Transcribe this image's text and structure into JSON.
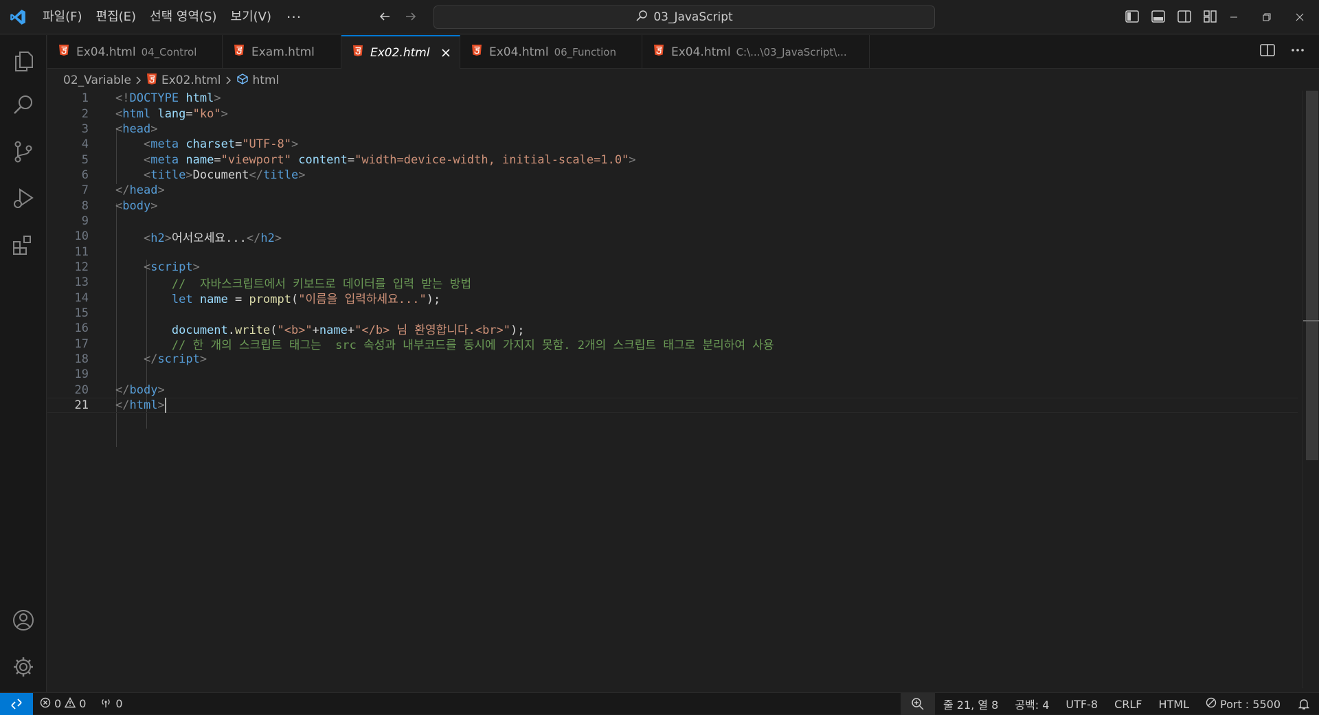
{
  "menu": {
    "items": [
      "파일(F)",
      "편집(E)",
      "선택 영역(S)",
      "보기(V)"
    ],
    "more": "···"
  },
  "search": {
    "text": "03_JavaScript"
  },
  "tabs": [
    {
      "name": "Ex04.html",
      "desc": "04_Control"
    },
    {
      "name": "Exam.html",
      "desc": ""
    },
    {
      "name": "Ex02.html",
      "desc": "",
      "active": true
    },
    {
      "name": "Ex04.html",
      "desc": "06_Function"
    },
    {
      "name": "Ex04.html",
      "desc": "C:\\...\\03_JavaScript\\..."
    }
  ],
  "breadcrumb": {
    "folder": "02_Variable",
    "file": "Ex02.html",
    "symbol": "html"
  },
  "editor": {
    "current_line": 21,
    "lines": [
      [
        [
          "c-punc",
          "<!"
        ],
        [
          "c-tag",
          "DOCTYPE"
        ],
        [
          "c-text",
          " "
        ],
        [
          "c-attr",
          "html"
        ],
        [
          "c-punc",
          ">"
        ]
      ],
      [
        [
          "c-punc",
          "<"
        ],
        [
          "c-tag",
          "html"
        ],
        [
          "c-text",
          " "
        ],
        [
          "c-attr",
          "lang"
        ],
        [
          "c-text",
          "="
        ],
        [
          "c-str",
          "\"ko\""
        ],
        [
          "c-punc",
          ">"
        ]
      ],
      [
        [
          "c-punc",
          "<"
        ],
        [
          "c-tag",
          "head"
        ],
        [
          "c-punc",
          ">"
        ]
      ],
      [
        [
          "c-text",
          "    "
        ],
        [
          "c-punc",
          "<"
        ],
        [
          "c-tag",
          "meta"
        ],
        [
          "c-text",
          " "
        ],
        [
          "c-attr",
          "charset"
        ],
        [
          "c-text",
          "="
        ],
        [
          "c-str",
          "\"UTF-8\""
        ],
        [
          "c-punc",
          ">"
        ]
      ],
      [
        [
          "c-text",
          "    "
        ],
        [
          "c-punc",
          "<"
        ],
        [
          "c-tag",
          "meta"
        ],
        [
          "c-text",
          " "
        ],
        [
          "c-attr",
          "name"
        ],
        [
          "c-text",
          "="
        ],
        [
          "c-str",
          "\"viewport\""
        ],
        [
          "c-text",
          " "
        ],
        [
          "c-attr",
          "content"
        ],
        [
          "c-text",
          "="
        ],
        [
          "c-str",
          "\"width=device-width, initial-scale=1.0\""
        ],
        [
          "c-punc",
          ">"
        ]
      ],
      [
        [
          "c-text",
          "    "
        ],
        [
          "c-punc",
          "<"
        ],
        [
          "c-tag",
          "title"
        ],
        [
          "c-punc",
          ">"
        ],
        [
          "c-text",
          "Document"
        ],
        [
          "c-punc",
          "</"
        ],
        [
          "c-tag",
          "title"
        ],
        [
          "c-punc",
          ">"
        ]
      ],
      [
        [
          "c-punc",
          "</"
        ],
        [
          "c-tag",
          "head"
        ],
        [
          "c-punc",
          ">"
        ]
      ],
      [
        [
          "c-punc",
          "<"
        ],
        [
          "c-tag",
          "body"
        ],
        [
          "c-punc",
          ">"
        ]
      ],
      [],
      [
        [
          "c-text",
          "    "
        ],
        [
          "c-punc",
          "<"
        ],
        [
          "c-tag",
          "h2"
        ],
        [
          "c-punc",
          ">"
        ],
        [
          "c-text",
          "어서오세요..."
        ],
        [
          "c-punc",
          "</"
        ],
        [
          "c-tag",
          "h2"
        ],
        [
          "c-punc",
          ">"
        ]
      ],
      [],
      [
        [
          "c-text",
          "    "
        ],
        [
          "c-punc",
          "<"
        ],
        [
          "c-tag",
          "script"
        ],
        [
          "c-punc",
          ">"
        ]
      ],
      [
        [
          "c-text",
          "        "
        ],
        [
          "c-cmt",
          "//  자바스크립트에서 키보드로 데이터를 입력 받는 방법"
        ]
      ],
      [
        [
          "c-text",
          "        "
        ],
        [
          "c-kw",
          "let"
        ],
        [
          "c-text",
          " "
        ],
        [
          "c-var",
          "name"
        ],
        [
          "c-text",
          " = "
        ],
        [
          "c-fn",
          "prompt"
        ],
        [
          "c-text",
          "("
        ],
        [
          "c-str",
          "\"이름을 입력하세요...\""
        ],
        [
          "c-text",
          ");"
        ]
      ],
      [],
      [
        [
          "c-text",
          "        "
        ],
        [
          "c-var",
          "document"
        ],
        [
          "c-text",
          "."
        ],
        [
          "c-fn",
          "write"
        ],
        [
          "c-text",
          "("
        ],
        [
          "c-str",
          "\"<b>\""
        ],
        [
          "c-text",
          "+"
        ],
        [
          "c-var",
          "name"
        ],
        [
          "c-text",
          "+"
        ],
        [
          "c-str",
          "\"</b> 님 환영합니다.<br>\""
        ],
        [
          "c-text",
          ");"
        ]
      ],
      [
        [
          "c-text",
          "        "
        ],
        [
          "c-cmt",
          "// 한 개의 스크립트 태그는  src 속성과 내부코드를 동시에 가지지 못함. 2개의 스크립트 태그로 분리하여 사용"
        ]
      ],
      [
        [
          "c-text",
          "    "
        ],
        [
          "c-punc",
          "</"
        ],
        [
          "c-tag",
          "script"
        ],
        [
          "c-punc",
          ">"
        ]
      ],
      [],
      [
        [
          "c-punc",
          "</"
        ],
        [
          "c-tag",
          "body"
        ],
        [
          "c-punc",
          ">"
        ]
      ],
      [
        [
          "c-punc",
          "</"
        ],
        [
          "c-tag",
          "html"
        ],
        [
          "c-punc",
          ">"
        ]
      ]
    ]
  },
  "status": {
    "errors": "0",
    "warnings": "0",
    "ports": "0",
    "position": "줄 21, 열 8",
    "spaces": "공백: 4",
    "encoding": "UTF-8",
    "eol": "CRLF",
    "language": "HTML",
    "live_server": "Port : 5500"
  },
  "colors": {
    "accent": "#0078d4",
    "html_icon": "#e44d26"
  }
}
